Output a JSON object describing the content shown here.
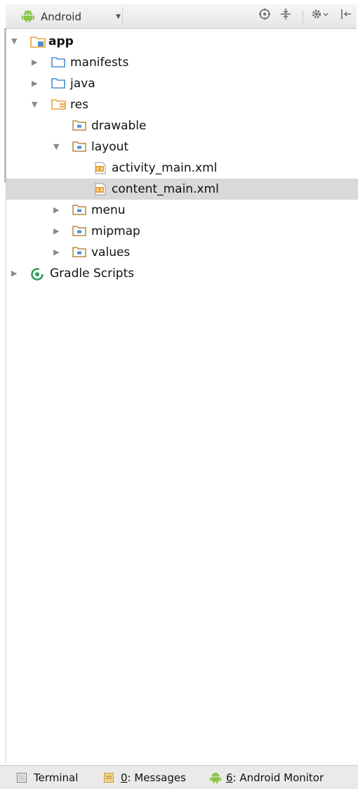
{
  "toolbar": {
    "view_mode": "Android",
    "icons": [
      "android-icon",
      "chevron-down-icon",
      "sync-target-icon",
      "collapse-all-icon",
      "gear-icon",
      "hide-panel-icon"
    ]
  },
  "tree": [
    {
      "label": "app",
      "bold": true,
      "expanded": true,
      "icon": "module-folder-icon"
    },
    {
      "label": "manifests",
      "expanded": false,
      "icon": "folder-icon"
    },
    {
      "label": "java",
      "expanded": false,
      "icon": "folder-icon"
    },
    {
      "label": "res",
      "expanded": true,
      "icon": "resource-folder-icon"
    },
    {
      "label": "drawable",
      "icon": "package-folder-icon"
    },
    {
      "label": "layout",
      "expanded": true,
      "icon": "package-folder-icon"
    },
    {
      "label": "activity_main.xml",
      "icon": "xml-file-icon"
    },
    {
      "label": "content_main.xml",
      "icon": "xml-file-icon",
      "selected": true
    },
    {
      "label": "menu",
      "expanded": false,
      "icon": "package-folder-icon"
    },
    {
      "label": "mipmap",
      "expanded": false,
      "icon": "package-folder-icon"
    },
    {
      "label": "values",
      "expanded": false,
      "icon": "package-folder-icon"
    },
    {
      "label": "Gradle Scripts",
      "expanded": false,
      "icon": "gradle-icon"
    }
  ],
  "bottom_tabs": [
    {
      "label": "Terminal",
      "icon": "terminal-icon"
    },
    {
      "mnemonic": "0",
      "label": ": Messages",
      "icon": "messages-icon"
    },
    {
      "mnemonic": "6",
      "label": ": Android Monitor",
      "icon": "android-icon"
    }
  ],
  "colors": {
    "selection": "#d9d9d9",
    "folder_blue": "#4a8fd0",
    "module_orange": "#e8a23a",
    "android_green": "#8cc34a",
    "gradle_green": "#2e9e58"
  }
}
